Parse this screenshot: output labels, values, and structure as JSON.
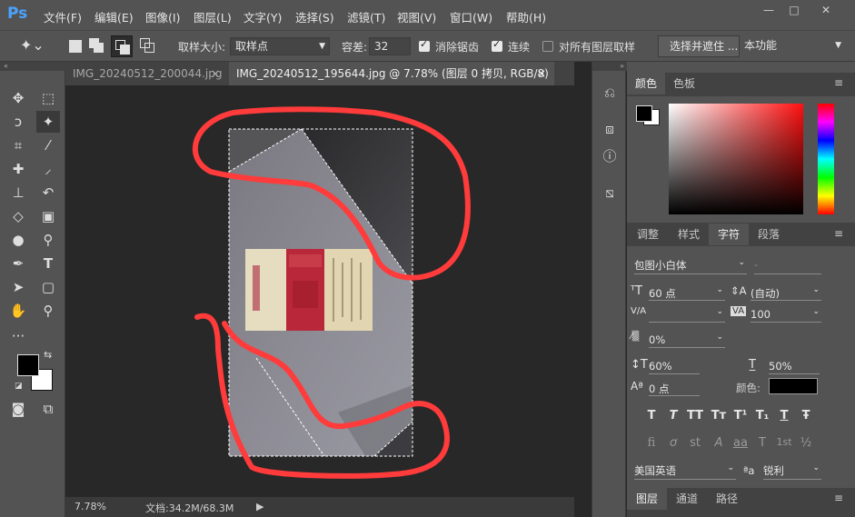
{
  "app": {
    "logo": "Ps"
  },
  "menu": [
    "文件(F)",
    "编辑(E)",
    "图像(I)",
    "图层(L)",
    "文字(Y)",
    "选择(S)",
    "滤镜(T)",
    "视图(V)",
    "窗口(W)",
    "帮助(H)"
  ],
  "window_controls": {
    "minimize": "—",
    "restore": "□",
    "close": "✕"
  },
  "options": {
    "sample_size_label": "取样大小:",
    "sample_size_value": "取样点",
    "tolerance_label": "容差:",
    "tolerance_value": "32",
    "antialias_label": "消除锯齿",
    "contiguous_label": "连续",
    "sample_all_label": "对所有图层取样",
    "select_mask_button": "选择并遮住 ...",
    "workspace_value": "本功能"
  },
  "tabs": [
    {
      "label": "IMG_20240512_200044.jpg",
      "close": "×",
      "active": false
    },
    {
      "label": "IMG_20240512_195644.jpg @ 7.78% (图层 0 拷贝, RGB/8) *",
      "close": "×",
      "active": true
    }
  ],
  "status": {
    "zoom": "7.78%",
    "doc_info": "文档:34.2M/68.3M"
  },
  "color_panel": {
    "tabs": [
      "颜色",
      "色板"
    ]
  },
  "adjust_tabs": [
    "调整",
    "样式",
    "字符",
    "段落"
  ],
  "character": {
    "font_family": "包图小白体",
    "font_style": "-",
    "font_size": "60 点",
    "leading": "(自动)",
    "kerning": "",
    "tracking": "100",
    "tsume": "0%",
    "vertical_scale": "60%",
    "horizontal_scale": "50%",
    "baseline_shift": "0 点",
    "color_label": "颜色:",
    "style_glyphs": [
      "T",
      "T",
      "TT",
      "Tт",
      "T¹",
      "T₁",
      "T",
      "Ŧ"
    ],
    "ot_glyphs": [
      "fi",
      "ơ",
      "st",
      "A",
      "aa",
      "T",
      "1st",
      "½"
    ],
    "language": "美国英语",
    "aa_label": "ªa",
    "antialias": "锐利"
  },
  "layers_tabs": [
    "图层",
    "通道",
    "路径"
  ],
  "colors": {
    "foreground": "#000000",
    "background": "#ffffff",
    "accent": "#4aa3ff",
    "annotation": "#ff3b3b"
  }
}
